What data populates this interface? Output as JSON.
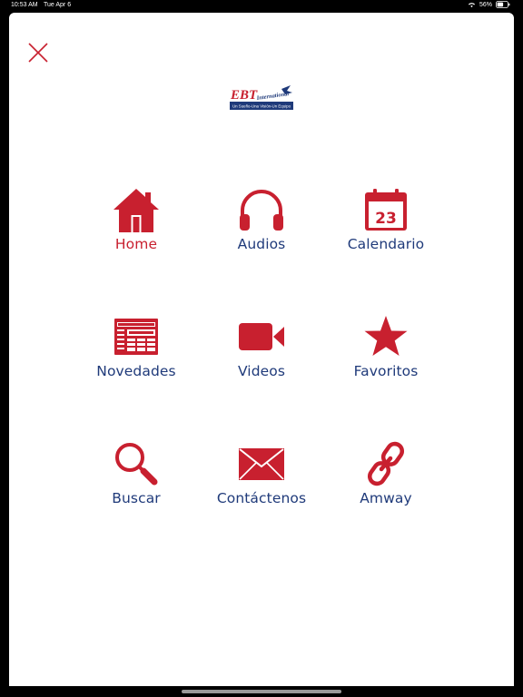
{
  "status_bar": {
    "time": "10:53 AM",
    "date": "Tue Apr 6",
    "battery": "56%"
  },
  "logo": {
    "brand_main": "EBT",
    "brand_script": "International",
    "tagline": "Un Sueño-Una Visión-Un Equipo"
  },
  "colors": {
    "accent_red": "#c8202f",
    "label_blue": "#1f3a7a"
  },
  "menu": [
    {
      "label": "Home",
      "icon": "house-icon",
      "active": true
    },
    {
      "label": "Audios",
      "icon": "headphones-icon"
    },
    {
      "label": "Calendario",
      "icon": "calendar-icon",
      "badge": "23"
    },
    {
      "label": "Novedades",
      "icon": "newspaper-icon"
    },
    {
      "label": "Videos",
      "icon": "video-camera-icon"
    },
    {
      "label": "Favoritos",
      "icon": "star-icon"
    },
    {
      "label": "Buscar",
      "icon": "magnifier-icon"
    },
    {
      "label": "Contáctenos",
      "icon": "envelope-icon"
    },
    {
      "label": "Amway",
      "icon": "link-icon"
    }
  ]
}
